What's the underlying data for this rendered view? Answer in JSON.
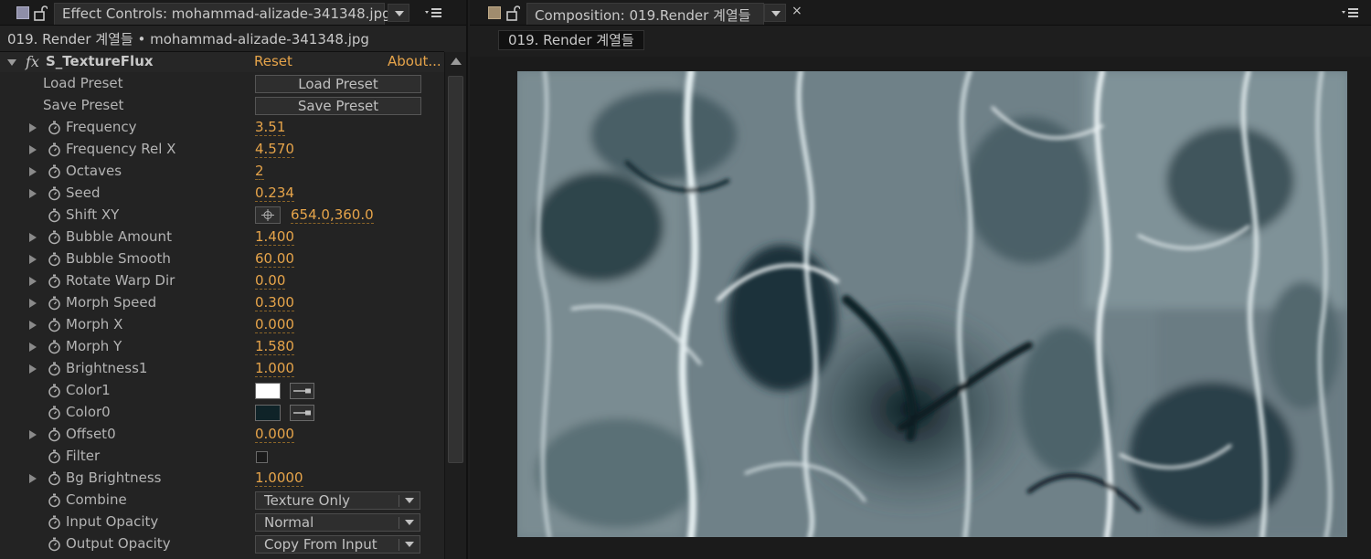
{
  "effect_controls": {
    "tab_title": "Effect Controls: mohammad-alizade-341348.jpg",
    "subtitle": "019. Render 계열들 • mohammad-alizade-341348.jpg",
    "effect": {
      "name": "S_TextureFlux",
      "reset_label": "Reset",
      "about_label": "About..."
    },
    "load_preset": {
      "label": "Load Preset",
      "button": "Load Preset"
    },
    "save_preset": {
      "label": "Save Preset",
      "button": "Save Preset"
    },
    "params": [
      {
        "label": "Frequency",
        "value": "3.51"
      },
      {
        "label": "Frequency Rel X",
        "value": "4.570"
      },
      {
        "label": "Octaves",
        "value": "2"
      },
      {
        "label": "Seed",
        "value": "0.234"
      },
      {
        "label": "Shift XY",
        "value": "654.0,360.0"
      },
      {
        "label": "Bubble Amount",
        "value": "1.400"
      },
      {
        "label": "Bubble Smooth",
        "value": "60.00"
      },
      {
        "label": "Rotate Warp Dir",
        "value": "0.00"
      },
      {
        "label": "Morph Speed",
        "value": "0.300"
      },
      {
        "label": "Morph X",
        "value": "0.000"
      },
      {
        "label": "Morph Y",
        "value": "1.580"
      },
      {
        "label": "Brightness1",
        "value": "1.000"
      },
      {
        "label": "Color1",
        "value": "#ffffff"
      },
      {
        "label": "Color0",
        "value": "#0f2328"
      },
      {
        "label": "Offset0",
        "value": "0.000"
      },
      {
        "label": "Filter",
        "value": ""
      },
      {
        "label": "Bg Brightness",
        "value": "1.0000"
      },
      {
        "label": "Combine",
        "value": "Texture Only"
      },
      {
        "label": "Input Opacity",
        "value": "Normal"
      },
      {
        "label": "Output Opacity",
        "value": "Copy From Input"
      }
    ],
    "filter_checked": false
  },
  "composition": {
    "tab_title": "Composition: 019.Render 계열들",
    "close_label": "×",
    "breadcrumb": "019. Render 계열들"
  },
  "colors": {
    "accent_value": "#e6a44a",
    "panel_bg": "#232323",
    "effect_swatch": "#8e8ea8",
    "comp_swatch": "#a08c6e"
  },
  "icons": [
    "lock-icon",
    "panel-menu-icon",
    "stopwatch-icon",
    "twirl-arrow-icon",
    "fx-icon",
    "crosshair-icon",
    "eyedropper-icon",
    "dropdown-arrow-icon",
    "close-icon",
    "scroll-up-icon"
  ]
}
